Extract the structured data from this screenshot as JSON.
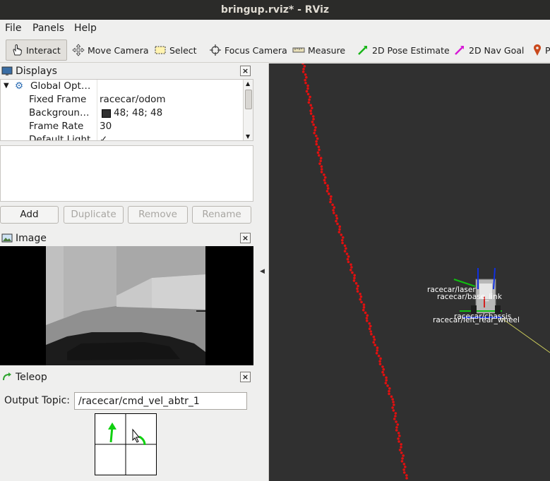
{
  "window": {
    "title": "bringup.rviz* - RViz"
  },
  "menu": {
    "file": "File",
    "panels": "Panels",
    "help": "Help"
  },
  "toolbar": {
    "interact": "Interact",
    "move_camera": "Move Camera",
    "select": "Select",
    "focus_camera": "Focus Camera",
    "measure": "Measure",
    "pose_estimate": "2D Pose Estimate",
    "nav_goal": "2D Nav Goal",
    "publish_point_partial": "P"
  },
  "displays_panel": {
    "title": "Displays",
    "rows": [
      {
        "key": "Global Opt…",
        "value": ""
      },
      {
        "key": "Fixed Frame",
        "value": "racecar/odom"
      },
      {
        "key": "Backgroun…",
        "value": "48; 48; 48"
      },
      {
        "key": "Frame Rate",
        "value": "30"
      },
      {
        "key": "Default Light",
        "value": "✓"
      }
    ],
    "buttons": {
      "add": "Add",
      "duplicate": "Duplicate",
      "remove": "Remove",
      "rename": "Rename"
    }
  },
  "image_panel": {
    "title": "Image"
  },
  "teleop_panel": {
    "title": "Teleop",
    "output_topic_label": "Output Topic:",
    "output_topic_value": "/racecar/cmd_vel_abtr_1"
  },
  "viewport": {
    "background_color": "#303030",
    "scan_color": "#e01010",
    "tf_labels": [
      "racecar/laser",
      "racecar/base_link",
      "racecar/chassis",
      "racecar/left_rear_wheel"
    ]
  }
}
